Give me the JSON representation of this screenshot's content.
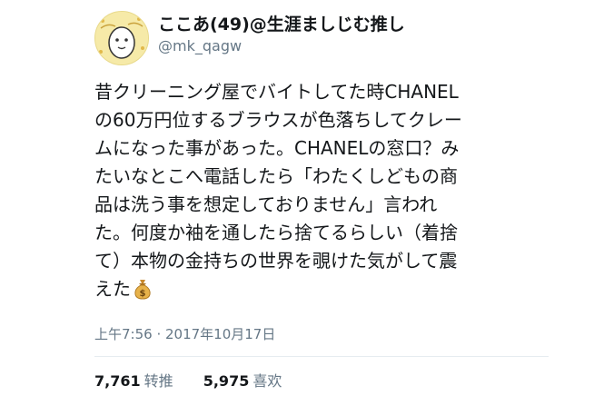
{
  "user": {
    "display_name": "ここあ(49)@生涯ましじむ推し",
    "handle": "@mk_qagw",
    "avatar_icon": "cartoon-egg-avatar-icon"
  },
  "tweet": {
    "lines": [
      "昔クリーニング屋でバイトしてた時CHANEL",
      "の60万円位するブラウスが色落ちしてクレー",
      "ムになった事があった。CHANELの窓口？み",
      "たいなとこへ電話したら「わたくしどもの商",
      "品は洗う事を想定しておりません」言われ",
      "た。何度か袖を通したら捨てるらしい（着捨",
      "て）本物の金持ちの世界を覗けた気がして震",
      "えた"
    ],
    "emoji_icon": "money-bag-icon",
    "timestamp": "上午7:56 · 2017年10月17日"
  },
  "stats": {
    "retweets_count": "7,761",
    "retweets_label": "转推",
    "likes_count": "5,975",
    "likes_label": "喜欢"
  }
}
